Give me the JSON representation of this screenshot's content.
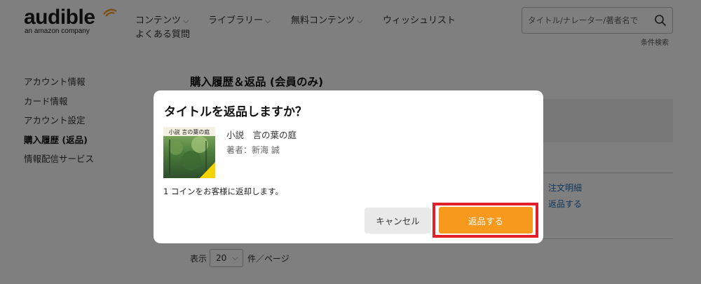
{
  "header": {
    "logo_word": "audible",
    "logo_sub": "an amazon company",
    "nav": [
      {
        "label": "コンテンツ",
        "dropdown": true
      },
      {
        "label": "ライブラリー",
        "dropdown": true
      },
      {
        "label": "無料コンテンツ",
        "dropdown": true
      },
      {
        "label": "ウィッシュリスト",
        "dropdown": false
      },
      {
        "label": "よくある質問",
        "dropdown": false
      }
    ],
    "search_placeholder": "タイトル/ナレーター/著者名で",
    "advanced_search": "条件検索"
  },
  "sidebar": {
    "items": [
      {
        "label": "アカウント情報",
        "active": false
      },
      {
        "label": "カード情報",
        "active": false
      },
      {
        "label": "アカウント設定",
        "active": false
      },
      {
        "label": "購入履歴 (返品)",
        "active": true
      },
      {
        "label": "情報配信サービス",
        "active": false
      }
    ]
  },
  "main": {
    "title": "購入履歴＆返品 (会員のみ)",
    "links": [
      "注文明細",
      "返品する"
    ],
    "per_page_prefix": "表示",
    "per_page_value": "20",
    "per_page_suffix": "件／ページ"
  },
  "modal": {
    "title": "タイトルを返品しますか？",
    "book_title": "小説　言の葉の庭",
    "book_author": "著者：新海 誠",
    "cover_title": "小説 言の葉の庭",
    "refund_note": "1 コインをお客様に返却します。",
    "cancel_label": "キャンセル",
    "return_label": "返品する"
  },
  "colors": {
    "accent": "#f7991c",
    "highlight_border": "#e3202a",
    "link": "#1f6fb5"
  }
}
